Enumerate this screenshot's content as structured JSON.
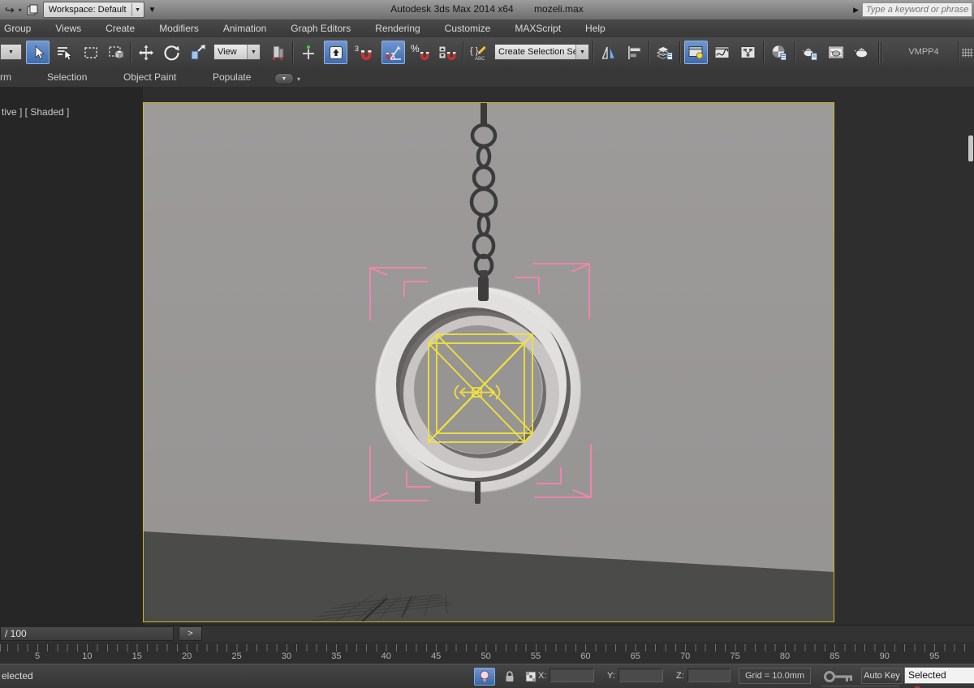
{
  "titlebar": {
    "workspace_label": "Workspace: Default",
    "app_title": "Autodesk 3ds Max  2014 x64",
    "file_name": "mozeli.max",
    "search_placeholder": "Type a keyword or phrase"
  },
  "menu": {
    "items": [
      {
        "label": "Group"
      },
      {
        "label": "Views"
      },
      {
        "label": "Create"
      },
      {
        "label": "Modifiers"
      },
      {
        "label": "Animation"
      },
      {
        "label": "Graph Editors"
      },
      {
        "label": "Rendering"
      },
      {
        "label": "Customize"
      },
      {
        "label": "MAXScript"
      },
      {
        "label": "Help"
      }
    ]
  },
  "toolbar": {
    "view_dropdown_value": "View",
    "snap_mode_label": "3",
    "selection_set_value": "Create Selection Se",
    "driver_label": "VMPP4"
  },
  "ribbon": {
    "tabs": [
      {
        "label": "rm"
      },
      {
        "label": "Selection"
      },
      {
        "label": "Object Paint"
      },
      {
        "label": "Populate"
      }
    ]
  },
  "viewport": {
    "label": "tive ] [ Shaded ]"
  },
  "timeline": {
    "time_display": "/ 100",
    "next_frame_label": ">",
    "labels": [
      5,
      10,
      15,
      20,
      25,
      30,
      35,
      40,
      45,
      50,
      55,
      60,
      65,
      70,
      75,
      80,
      85,
      90,
      95
    ]
  },
  "statusbar": {
    "prompt": "elected",
    "x_label": "X:",
    "y_label": "Y:",
    "z_label": "Z:",
    "x_value": "",
    "y_value": "",
    "z_value": "",
    "grid_label": "Grid = 10.0mm",
    "auto_key_label": "Auto Key",
    "key_filter_value": "Selected"
  },
  "colors": {
    "viewport_border": "#c8ba28",
    "selection_wireframe_yellow": "#f0e23a",
    "bracket_pink": "#f584ad",
    "highlight_blue": "#4d7cc0",
    "magnet_red": "#c23434"
  }
}
